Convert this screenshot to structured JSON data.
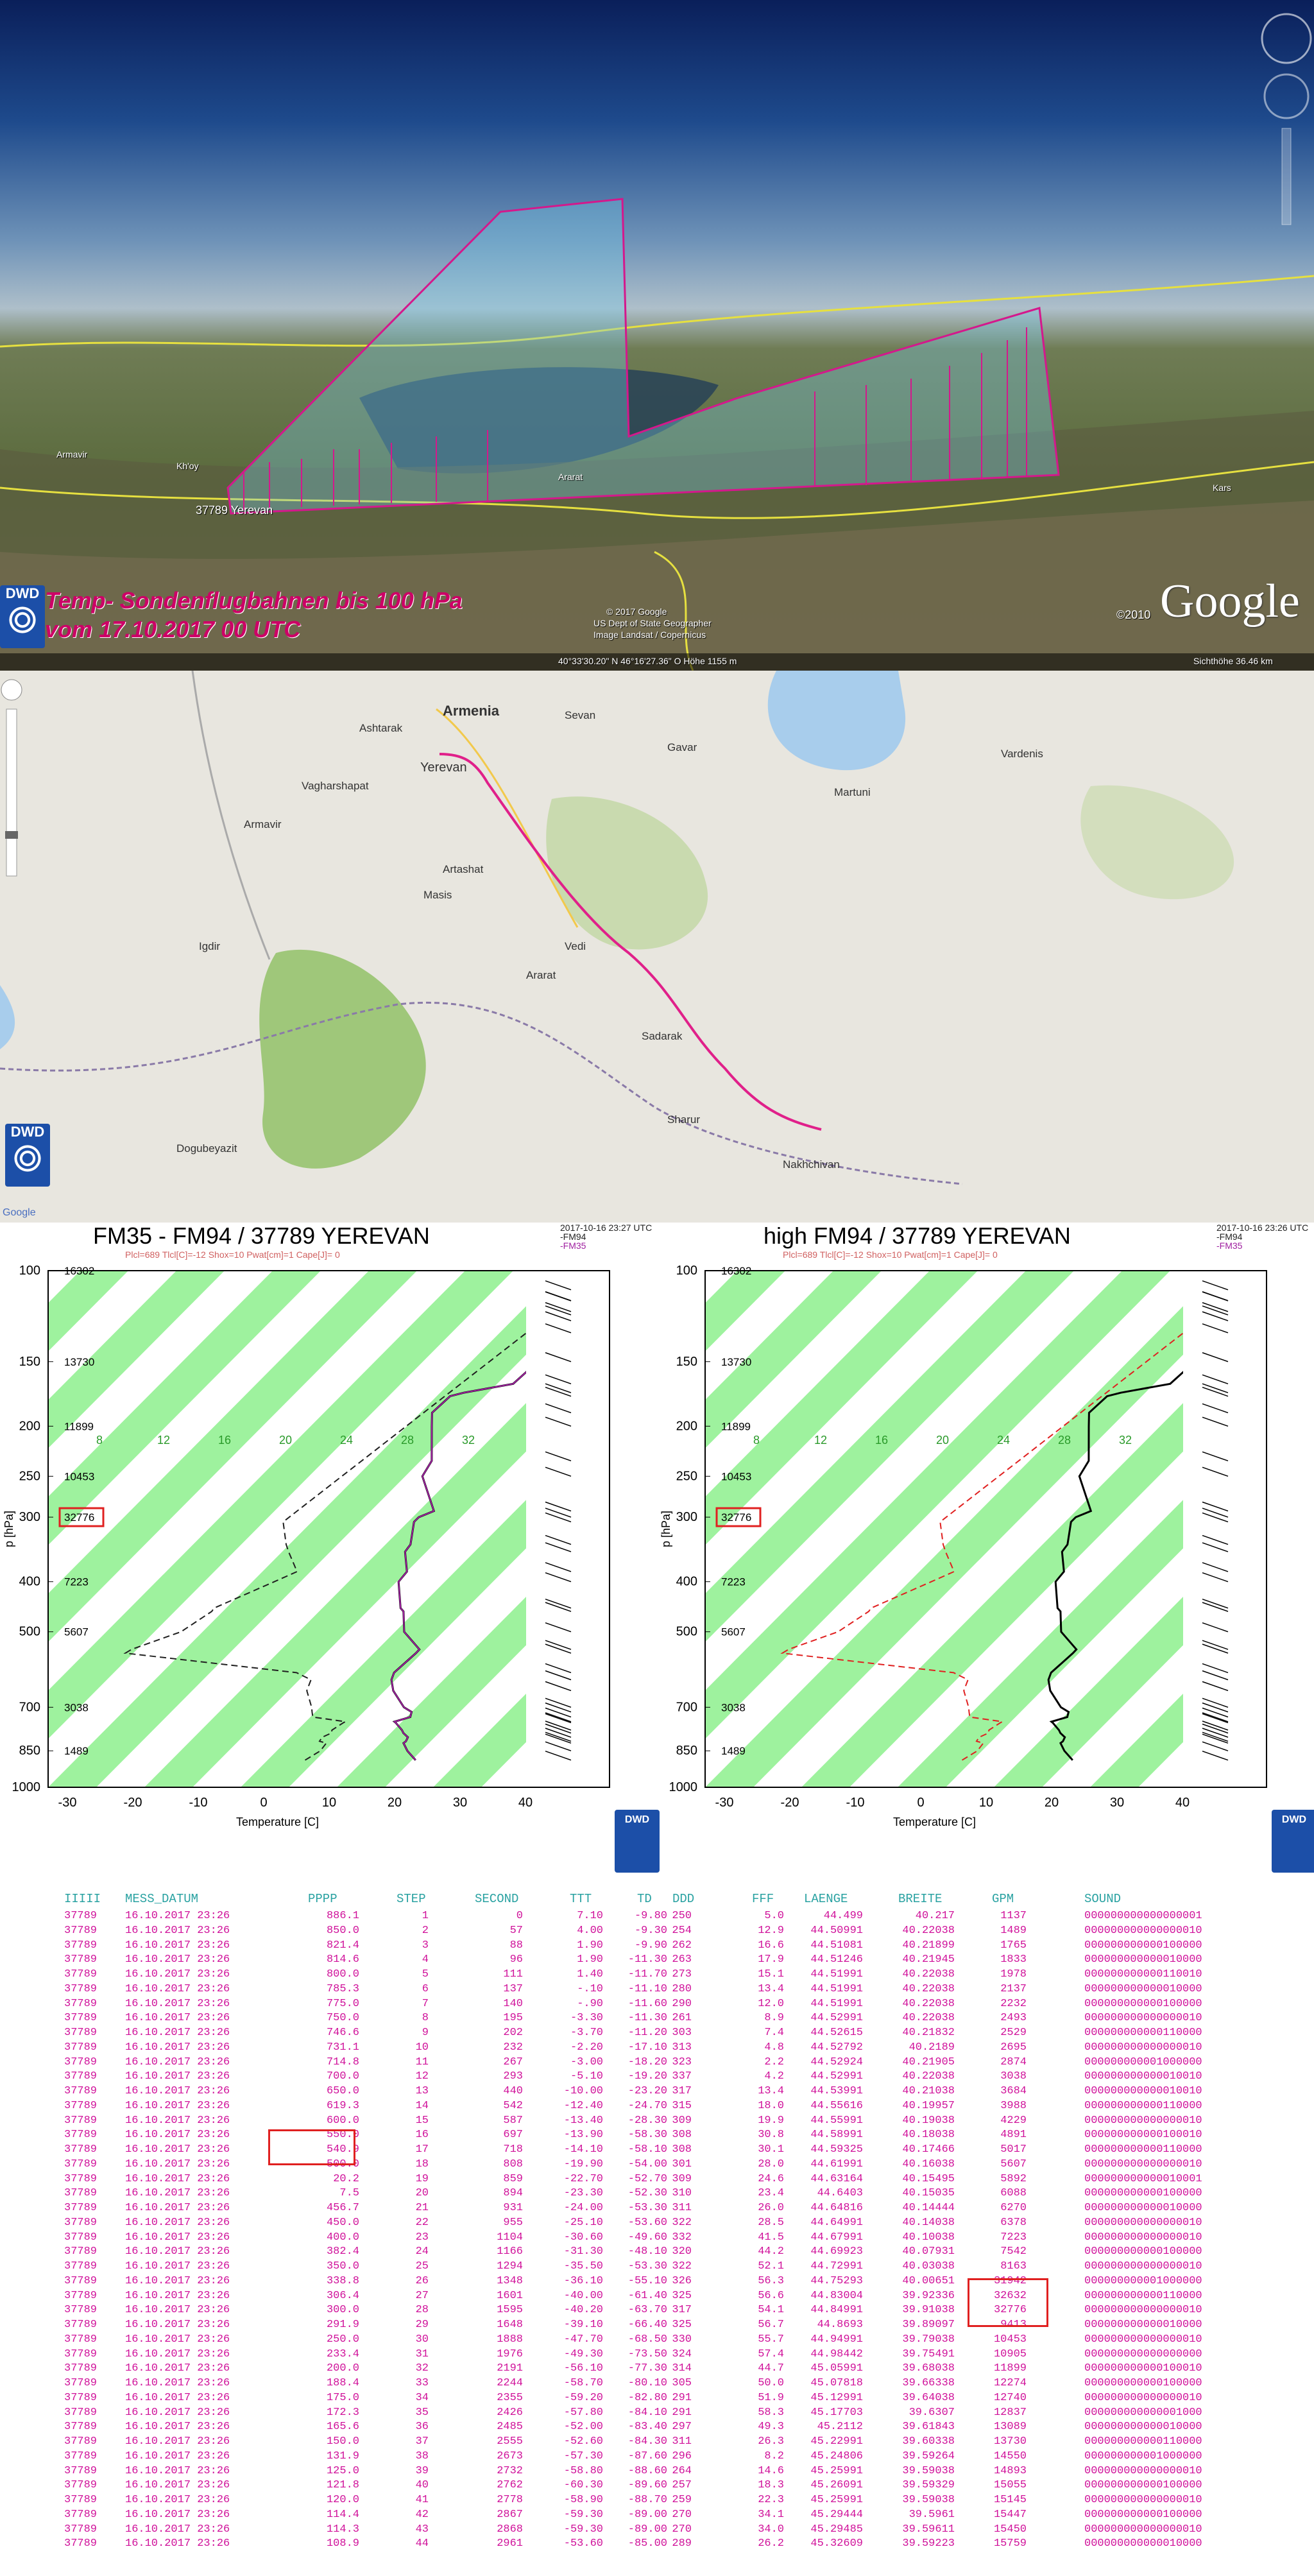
{
  "earth": {
    "title_line1": "Temp- Sondenflugbahnen bis 100 hPa",
    "title_line2": "vom 17.10.2017 00 UTC",
    "station_label": "37789 Yerevan",
    "place_labels": [
      "Armavir",
      "Kh'oy",
      "Ararat",
      "Kars"
    ],
    "copyright_lines": [
      "© 2017 Google",
      "US Dept of State Geographer",
      "Image Landsat / Copernicus"
    ],
    "coordinate_readout": "40°33'30.20\" N  46°16'27.36\" O  Höhe 1155 m",
    "eye_alt": "Sichthöhe   36.46 km",
    "year_credit": "©2010",
    "google_logo": "Google",
    "dwd_logo": "DWD"
  },
  "map": {
    "country_label": "Armenia",
    "city_labels": [
      {
        "name": "Yerevan"
      },
      {
        "name": "Sevan"
      },
      {
        "name": "Martuni"
      },
      {
        "name": "Vardenis"
      },
      {
        "name": "Ararat"
      },
      {
        "name": "Masis"
      },
      {
        "name": "Artashat"
      },
      {
        "name": "Vagharshapat"
      },
      {
        "name": "Armavir"
      },
      {
        "name": "Igdir"
      },
      {
        "name": "Dogubeyazit"
      },
      {
        "name": "Nakhchivan"
      },
      {
        "name": "Sharur"
      },
      {
        "name": "Sadarak"
      },
      {
        "name": "Ashtarak"
      },
      {
        "name": "Gavar"
      },
      {
        "name": "Vedi"
      }
    ],
    "dwd_logo": "DWD",
    "google_credit": "Google"
  },
  "skewt": {
    "left": {
      "title": "FM35 - FM94 / 37789 YEREVAN",
      "timestamp": "2017-10-16 23:27 UTC",
      "legend": [
        "-FM94",
        "-FM35"
      ],
      "indices": "Plcl=689 Tlcl[C]=-12 Shox=10 Pwat[cm]=1 Cape[J]= 0",
      "gpm_labels": [
        "16302",
        "13730",
        "11899",
        "10453",
        "32776",
        "7223",
        "5607",
        "3038",
        "1489"
      ]
    },
    "right": {
      "title": "high FM94 / 37789 YEREVAN",
      "timestamp": "2017-10-16 23:26 UTC",
      "legend": [
        "-FM94",
        "-FM35"
      ],
      "indices": "Plcl=689 Tlcl[C]=-12 Shox=10 Pwat[cm]=1 Cape[J]= 0",
      "gpm_labels": [
        "16302",
        "13730",
        "11899",
        "10453",
        "32776",
        "7223",
        "5607",
        "3038",
        "1489"
      ]
    },
    "y_axis_label": "p [hPa]",
    "x_axis_label": "Temperature [C]",
    "p_ticks": [
      "100",
      "150",
      "200",
      "250",
      "300",
      "400",
      "500",
      "700",
      "850",
      "1000"
    ],
    "t_ticks": [
      "-30",
      "-20",
      "-10",
      "0",
      "10",
      "20",
      "30",
      "40"
    ],
    "isotherm_labels": [
      "8",
      "12",
      "16",
      "20",
      "24",
      "28",
      "32"
    ],
    "dwd_logo": "DWD"
  },
  "table": {
    "headers": [
      "IIIII",
      "MESS_DATUM",
      "PPPP",
      "STEP",
      "SECOND",
      "TTT",
      "TD",
      "DDD",
      "FFF",
      "LAENGE",
      "BREITE",
      "GPM",
      "SOUND"
    ],
    "rows": [
      [
        "37789",
        "16.10.2017 23:26",
        "886.1",
        "1",
        "0",
        "7.10",
        "-9.80",
        "250",
        "5.0",
        "44.499",
        "40.217",
        "1137",
        "000000000000000001"
      ],
      [
        "37789",
        "16.10.2017 23:26",
        "850.0",
        "2",
        "57",
        "4.00",
        "-9.30",
        "254",
        "12.9",
        "44.50991",
        "40.22038",
        "1489",
        "000000000000000010"
      ],
      [
        "37789",
        "16.10.2017 23:26",
        "821.4",
        "3",
        "88",
        "1.90",
        "-9.90",
        "262",
        "16.6",
        "44.51081",
        "40.21899",
        "1765",
        "000000000000100000"
      ],
      [
        "37789",
        "16.10.2017 23:26",
        "814.6",
        "4",
        "96",
        "1.90",
        "-11.30",
        "263",
        "17.9",
        "44.51246",
        "40.21945",
        "1833",
        "000000000000010000"
      ],
      [
        "37789",
        "16.10.2017 23:26",
        "800.0",
        "5",
        "111",
        "1.40",
        "-11.70",
        "273",
        "15.1",
        "44.51991",
        "40.22038",
        "1978",
        "000000000000110010"
      ],
      [
        "37789",
        "16.10.2017 23:26",
        "785.3",
        "6",
        "137",
        "-.10",
        "-11.10",
        "280",
        "13.4",
        "44.51991",
        "40.22038",
        "2137",
        "000000000000010000"
      ],
      [
        "37789",
        "16.10.2017 23:26",
        "775.0",
        "7",
        "140",
        "-.90",
        "-11.60",
        "290",
        "12.0",
        "44.51991",
        "40.22038",
        "2232",
        "000000000000100000"
      ],
      [
        "37789",
        "16.10.2017 23:26",
        "750.0",
        "8",
        "195",
        "-3.30",
        "-11.30",
        "261",
        "8.9",
        "44.52991",
        "40.22038",
        "2493",
        "000000000000000010"
      ],
      [
        "37789",
        "16.10.2017 23:26",
        "746.6",
        "9",
        "202",
        "-3.70",
        "-11.20",
        "303",
        "7.4",
        "44.52615",
        "40.21832",
        "2529",
        "000000000000110000"
      ],
      [
        "37789",
        "16.10.2017 23:26",
        "731.1",
        "10",
        "232",
        "-2.20",
        "-17.10",
        "313",
        "4.8",
        "44.52792",
        "40.2189",
        "2695",
        "000000000000000010"
      ],
      [
        "37789",
        "16.10.2017 23:26",
        "714.8",
        "11",
        "267",
        "-3.00",
        "-18.20",
        "323",
        "2.2",
        "44.52924",
        "40.21905",
        "2874",
        "000000000001000000"
      ],
      [
        "37789",
        "16.10.2017 23:26",
        "700.0",
        "12",
        "293",
        "-5.10",
        "-19.20",
        "337",
        "4.2",
        "44.52991",
        "40.22038",
        "3038",
        "000000000000010010"
      ],
      [
        "37789",
        "16.10.2017 23:26",
        "650.0",
        "13",
        "440",
        "-10.00",
        "-23.20",
        "317",
        "13.4",
        "44.53991",
        "40.21038",
        "3684",
        "000000000000010010"
      ],
      [
        "37789",
        "16.10.2017 23:26",
        "619.3",
        "14",
        "542",
        "-12.40",
        "-24.70",
        "315",
        "18.0",
        "44.55616",
        "40.19957",
        "3988",
        "000000000000110000"
      ],
      [
        "37789",
        "16.10.2017 23:26",
        "600.0",
        "15",
        "587",
        "-13.40",
        "-28.30",
        "309",
        "19.9",
        "44.55991",
        "40.19038",
        "4229",
        "000000000000000010"
      ],
      [
        "37789",
        "16.10.2017 23:26",
        "550.0",
        "16",
        "697",
        "-13.90",
        "-58.30",
        "308",
        "30.8",
        "44.58991",
        "40.18038",
        "4891",
        "000000000000100010"
      ],
      [
        "37789",
        "16.10.2017 23:26",
        "540.9",
        "17",
        "718",
        "-14.10",
        "-58.10",
        "308",
        "30.1",
        "44.59325",
        "40.17466",
        "5017",
        "000000000000110000"
      ],
      [
        "37789",
        "16.10.2017 23:26",
        "500.0",
        "18",
        "808",
        "-19.90",
        "-54.00",
        "301",
        "28.0",
        "44.61991",
        "40.16038",
        "5607",
        "000000000000000010"
      ],
      [
        "37789",
        "16.10.2017 23:26",
        "20.2",
        "19",
        "859",
        "-22.70",
        "-52.70",
        "309",
        "24.6",
        "44.63164",
        "40.15495",
        "5892",
        "000000000000010001"
      ],
      [
        "37789",
        "16.10.2017 23:26",
        "7.5",
        "20",
        "894",
        "-23.30",
        "-52.30",
        "310",
        "23.4",
        "44.6403",
        "40.15035",
        "6088",
        "000000000000100000"
      ],
      [
        "37789",
        "16.10.2017 23:26",
        "456.7",
        "21",
        "931",
        "-24.00",
        "-53.30",
        "311",
        "26.0",
        "44.64816",
        "40.14444",
        "6270",
        "000000000000010000"
      ],
      [
        "37789",
        "16.10.2017 23:26",
        "450.0",
        "22",
        "955",
        "-25.10",
        "-53.60",
        "322",
        "28.5",
        "44.64991",
        "40.14038",
        "6378",
        "000000000000000010"
      ],
      [
        "37789",
        "16.10.2017 23:26",
        "400.0",
        "23",
        "1104",
        "-30.60",
        "-49.60",
        "332",
        "41.5",
        "44.67991",
        "40.10038",
        "7223",
        "000000000000000010"
      ],
      [
        "37789",
        "16.10.2017 23:26",
        "382.4",
        "24",
        "1166",
        "-31.30",
        "-48.10",
        "320",
        "44.2",
        "44.69923",
        "40.07931",
        "7542",
        "000000000000100000"
      ],
      [
        "37789",
        "16.10.2017 23:26",
        "350.0",
        "25",
        "1294",
        "-35.50",
        "-53.30",
        "322",
        "52.1",
        "44.72991",
        "40.03038",
        "8163",
        "000000000000000010"
      ],
      [
        "37789",
        "16.10.2017 23:26",
        "338.8",
        "26",
        "1348",
        "-36.10",
        "-55.10",
        "326",
        "56.3",
        "44.75293",
        "40.00651",
        "31942",
        "000000000001000000"
      ],
      [
        "37789",
        "16.10.2017 23:26",
        "306.4",
        "27",
        "1601",
        "-40.00",
        "-61.40",
        "325",
        "56.6",
        "44.83004",
        "39.92336",
        "32632",
        "000000000000110000"
      ],
      [
        "37789",
        "16.10.2017 23:26",
        "300.0",
        "28",
        "1595",
        "-40.20",
        "-63.70",
        "317",
        "54.1",
        "44.84991",
        "39.91038",
        "32776",
        "000000000000000010"
      ],
      [
        "37789",
        "16.10.2017 23:26",
        "291.9",
        "29",
        "1648",
        "-39.10",
        "-66.40",
        "325",
        "56.7",
        "44.8693",
        "39.89097",
        "9413",
        "000000000000010000"
      ],
      [
        "37789",
        "16.10.2017 23:26",
        "250.0",
        "30",
        "1888",
        "-47.70",
        "-68.50",
        "330",
        "55.7",
        "44.94991",
        "39.79038",
        "10453",
        "000000000000000010"
      ],
      [
        "37789",
        "16.10.2017 23:26",
        "233.4",
        "31",
        "1976",
        "-49.30",
        "-73.50",
        "324",
        "57.4",
        "44.98442",
        "39.75491",
        "10905",
        "000000000000000000"
      ],
      [
        "37789",
        "16.10.2017 23:26",
        "200.0",
        "32",
        "2191",
        "-56.10",
        "-77.30",
        "314",
        "44.7",
        "45.05991",
        "39.68038",
        "11899",
        "000000000000100010"
      ],
      [
        "37789",
        "16.10.2017 23:26",
        "188.4",
        "33",
        "2244",
        "-58.70",
        "-80.10",
        "305",
        "50.0",
        "45.07818",
        "39.66338",
        "12274",
        "000000000000100000"
      ],
      [
        "37789",
        "16.10.2017 23:26",
        "175.0",
        "34",
        "2355",
        "-59.20",
        "-82.80",
        "291",
        "51.9",
        "45.12991",
        "39.64038",
        "12740",
        "000000000000000010"
      ],
      [
        "37789",
        "16.10.2017 23:26",
        "172.3",
        "35",
        "2426",
        "-57.80",
        "-84.10",
        "291",
        "58.3",
        "45.17703",
        "39.6307",
        "12837",
        "000000000000001000"
      ],
      [
        "37789",
        "16.10.2017 23:26",
        "165.6",
        "36",
        "2485",
        "-52.00",
        "-83.40",
        "297",
        "49.3",
        "45.2112",
        "39.61843",
        "13089",
        "000000000000010000"
      ],
      [
        "37789",
        "16.10.2017 23:26",
        "150.0",
        "37",
        "2555",
        "-52.60",
        "-84.30",
        "311",
        "26.3",
        "45.22991",
        "39.60338",
        "13730",
        "000000000000110000"
      ],
      [
        "37789",
        "16.10.2017 23:26",
        "131.9",
        "38",
        "2673",
        "-57.30",
        "-87.60",
        "296",
        "8.2",
        "45.24806",
        "39.59264",
        "14550",
        "000000000001000000"
      ],
      [
        "37789",
        "16.10.2017 23:26",
        "125.0",
        "39",
        "2732",
        "-58.80",
        "-88.60",
        "264",
        "14.6",
        "45.25991",
        "39.59038",
        "14893",
        "000000000000000010"
      ],
      [
        "37789",
        "16.10.2017 23:26",
        "121.8",
        "40",
        "2762",
        "-60.30",
        "-89.60",
        "257",
        "18.3",
        "45.26091",
        "39.59329",
        "15055",
        "000000000000100000"
      ],
      [
        "37789",
        "16.10.2017 23:26",
        "120.0",
        "41",
        "2778",
        "-58.90",
        "-88.70",
        "259",
        "22.3",
        "45.25991",
        "39.59038",
        "15145",
        "000000000000000010"
      ],
      [
        "37789",
        "16.10.2017 23:26",
        "114.4",
        "42",
        "2867",
        "-59.30",
        "-89.00",
        "270",
        "34.1",
        "45.29444",
        "39.5961",
        "15447",
        "000000000000100000"
      ],
      [
        "37789",
        "16.10.2017 23:26",
        "114.3",
        "43",
        "2868",
        "-59.30",
        "-89.00",
        "270",
        "34.0",
        "45.29485",
        "39.59611",
        "15450",
        "000000000000000010"
      ],
      [
        "37789",
        "16.10.2017 23:26",
        "108.9",
        "44",
        "2961",
        "-53.60",
        "-85.00",
        "289",
        "26.2",
        "45.32609",
        "39.59223",
        "15759",
        "000000000000010000"
      ]
    ]
  }
}
